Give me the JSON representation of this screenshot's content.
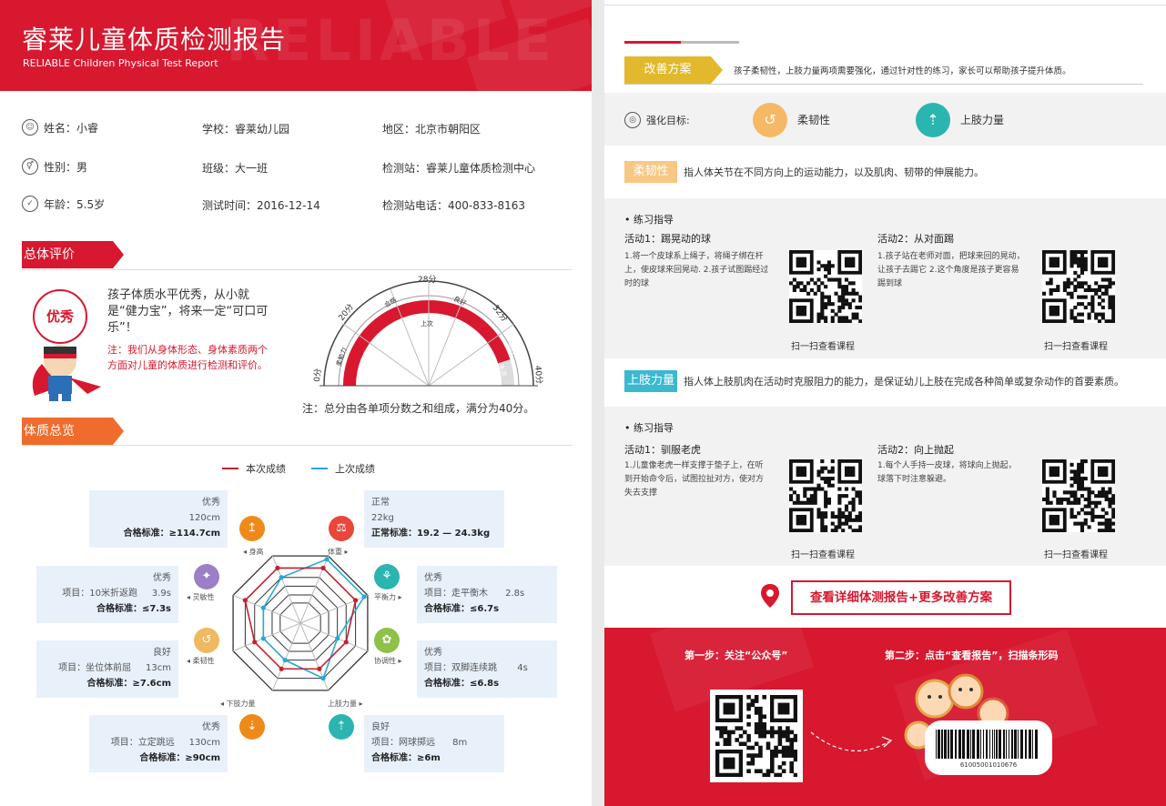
{
  "header": {
    "title": "睿莱儿童体质检测报告",
    "subtitle": "RELIABLE Children Physical Test Report",
    "watermark": "RELIABLE"
  },
  "info": {
    "name": "姓名：小睿",
    "school": "学校：睿莱幼儿园",
    "region": "地区：北京市朝阳区",
    "gender": "性别：男",
    "class": "班级：大一班",
    "station": "检测站：睿莱儿童体质检测中心",
    "age": "年龄：5.5岁",
    "time": "测试时间：2016-12-14",
    "phone": "检测站电话：400-833-8163"
  },
  "overall": {
    "tab": "总体评价",
    "badge": "优秀",
    "desc": "孩子体质水平优秀，从小就是“健力宝”，将来一定“可口可乐”！",
    "note": "注：我们从身体形态、身体素质两个方面对儿童的体质进行检测和评价。",
    "gauge_note": "注：总分由各单项分数之和组成，满分为40分。",
    "gauge_labels": {
      "s0": "0分",
      "s20": "20分",
      "s28": "28分",
      "s32": "32分",
      "s40": "40分",
      "z1": "柔勉力",
      "z2": "合格",
      "z3": "良好",
      "z4": "优秀",
      "last": "上次",
      "this": "本次"
    },
    "score_value": 36
  },
  "overview": {
    "tab": "体质总览",
    "legend_this": "本次成绩",
    "legend_last": "上次成绩",
    "axes": [
      "身高",
      "体重",
      "平衡力",
      "协调性",
      "上肢力量",
      "下肢力量",
      "柔韧性",
      "灵敏性"
    ],
    "this_values": [
      0.82,
      0.82,
      0.82,
      0.68,
      0.68,
      0.68,
      0.68,
      0.82
    ],
    "last_values": [
      0.68,
      0.95,
      0.95,
      0.55,
      0.82,
      0.55,
      0.55,
      0.55
    ],
    "colors": {
      "this": "#c0232f",
      "last": "#27a9d8"
    },
    "items": {
      "height": {
        "grade": "优秀",
        "value": "120cm",
        "std": "合格标准：≥114.7cm"
      },
      "weight": {
        "grade": "正常",
        "value": "22kg",
        "std": "正常标准：19.2 — 24.3kg"
      },
      "agility": {
        "grade": "优秀",
        "item": "项目：10米折返跑",
        "value": "3.9s",
        "std": "合格标准：≤7.3s"
      },
      "balance": {
        "grade": "优秀",
        "item": "项目：走平衡木",
        "value": "2.8s",
        "std": "合格标准：≤6.7s"
      },
      "flex": {
        "grade": "良好",
        "item": "项目：坐位体前屈",
        "value": "13cm",
        "std": "合格标准：≥7.6cm"
      },
      "coord": {
        "grade": "优秀",
        "item": "项目：双脚连续跳",
        "value": "4s",
        "std": "合格标准：≤6.8s"
      },
      "lower": {
        "grade": "优秀",
        "item": "项目：立定跳远",
        "value": "130cm",
        "std": "合格标准：≥90cm"
      },
      "upper": {
        "grade": "良好",
        "item": "项目：网球掷远",
        "value": "8m",
        "std": "合格标准：≥6m"
      }
    }
  },
  "plan": {
    "tab": "改善方案",
    "desc": "孩子柔韧性，上肢力量两项需要强化，通过针对性的练习，家长可以帮助孩子提升体质。",
    "target_label": "强化目标:",
    "target1": "柔韧性",
    "target2": "上肢力量",
    "flex_tag": "柔韧性",
    "flex_desc": "指人体关节在不同方向上的运动能力，以及肌肉、韧带的伸展能力。",
    "practice": "• 练习指导",
    "f_act1_title": "活动1：踢晃动的球",
    "f_act1_desc": "1.将一个皮球系上绳子，将绳子绑在杆上，使皮球来回晃动. 2.孩子试图踢经过时的球",
    "f_act2_title": "活动2：从对面踢",
    "f_act2_desc": "1.孩子站在老师对面，把球来回的晃动，让孩子去踢它 2.这个角度是孩子更容易踢到球",
    "scan": "扫一扫查看课程",
    "upper_tag": "上肢力量",
    "upper_desc": "指人体上肢肌肉在活动时克服阻力的能力，是保证幼儿上肢在完成各种简单或复杂动作的首要素质。",
    "u_act1_title": "活动1：驯服老虎",
    "u_act1_desc": "1.儿童像老虎一样支撑于垫子上，在听到开始命令后，试图拉扯对方，使对方失去支撑",
    "u_act2_title": "活动2：向上抛起",
    "u_act2_desc": "1.每个人手持一皮球，将球向上抛起，球落下时注意躲避。",
    "more_btn": "查看详细体测报告+更多改善方案",
    "step1": "第一步：关注“公众号”",
    "step2": "第二步：点击“查看报告”，扫描条形码",
    "barcode": "61005001010676"
  }
}
